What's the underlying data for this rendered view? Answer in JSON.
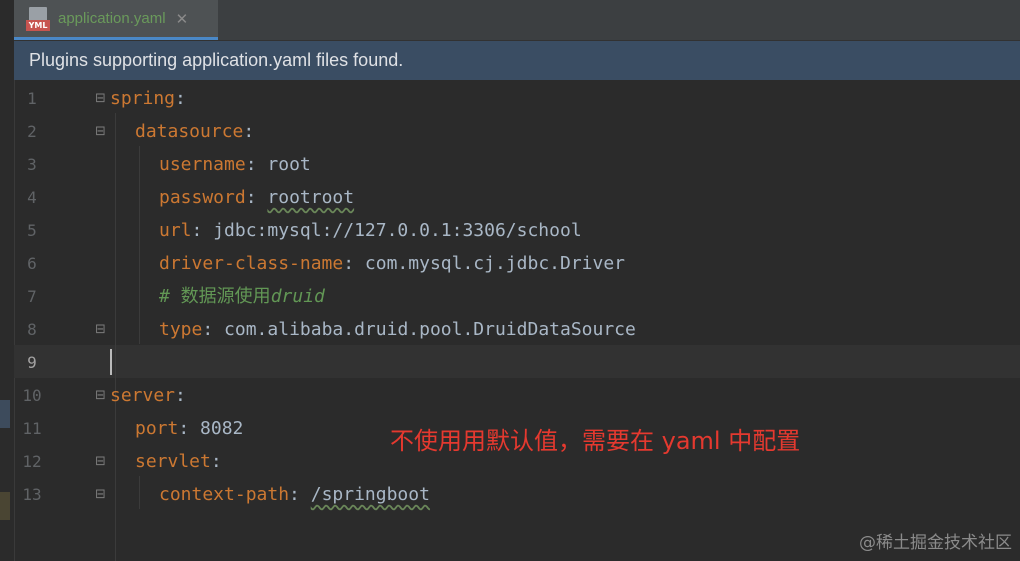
{
  "tab": {
    "icon": "yml-file-icon",
    "icon_badge": "YML",
    "label": "application.yaml",
    "close": "✕"
  },
  "banner": {
    "text": "Plugins supporting application.yaml files found."
  },
  "editor": {
    "current_line": "9",
    "lines": [
      {
        "n": "1",
        "key": "spring",
        "sep": ":",
        "value": ""
      },
      {
        "n": "2",
        "key": "datasource",
        "sep": ":",
        "value": ""
      },
      {
        "n": "3",
        "key": "username",
        "sep": ": ",
        "value": "root"
      },
      {
        "n": "4",
        "key": "password",
        "sep": ": ",
        "value": "rootroot"
      },
      {
        "n": "5",
        "key": "url",
        "sep": ": ",
        "value": "jdbc:mysql://127.0.0.1:3306/school"
      },
      {
        "n": "6",
        "key": "driver-class-name",
        "sep": ": ",
        "value": "com.mysql.cj.jdbc.Driver"
      },
      {
        "n": "7",
        "comment": "# 数据源使用",
        "comment_italic": "druid"
      },
      {
        "n": "8",
        "key": "type",
        "sep": ": ",
        "value": "com.alibaba.druid.pool.DruidDataSource"
      },
      {
        "n": "9"
      },
      {
        "n": "10",
        "key": "server",
        "sep": ":",
        "value": ""
      },
      {
        "n": "11",
        "key": "port",
        "sep": ": ",
        "value": "8082"
      },
      {
        "n": "12",
        "key": "servlet",
        "sep": ":",
        "value": ""
      },
      {
        "n": "13",
        "key": "context-path",
        "sep": ": ",
        "value": "/springboot"
      }
    ]
  },
  "annotation": "不使用用默认值，需要在 yaml 中配置",
  "watermark": "@稀土掘金技术社区",
  "colors": {
    "key": "#cc7832",
    "value": "#a9b7c6",
    "comment": "#629755",
    "annotation": "#e5392f",
    "banner_bg": "#3a4d63",
    "tab_underline": "#4a88c7"
  }
}
